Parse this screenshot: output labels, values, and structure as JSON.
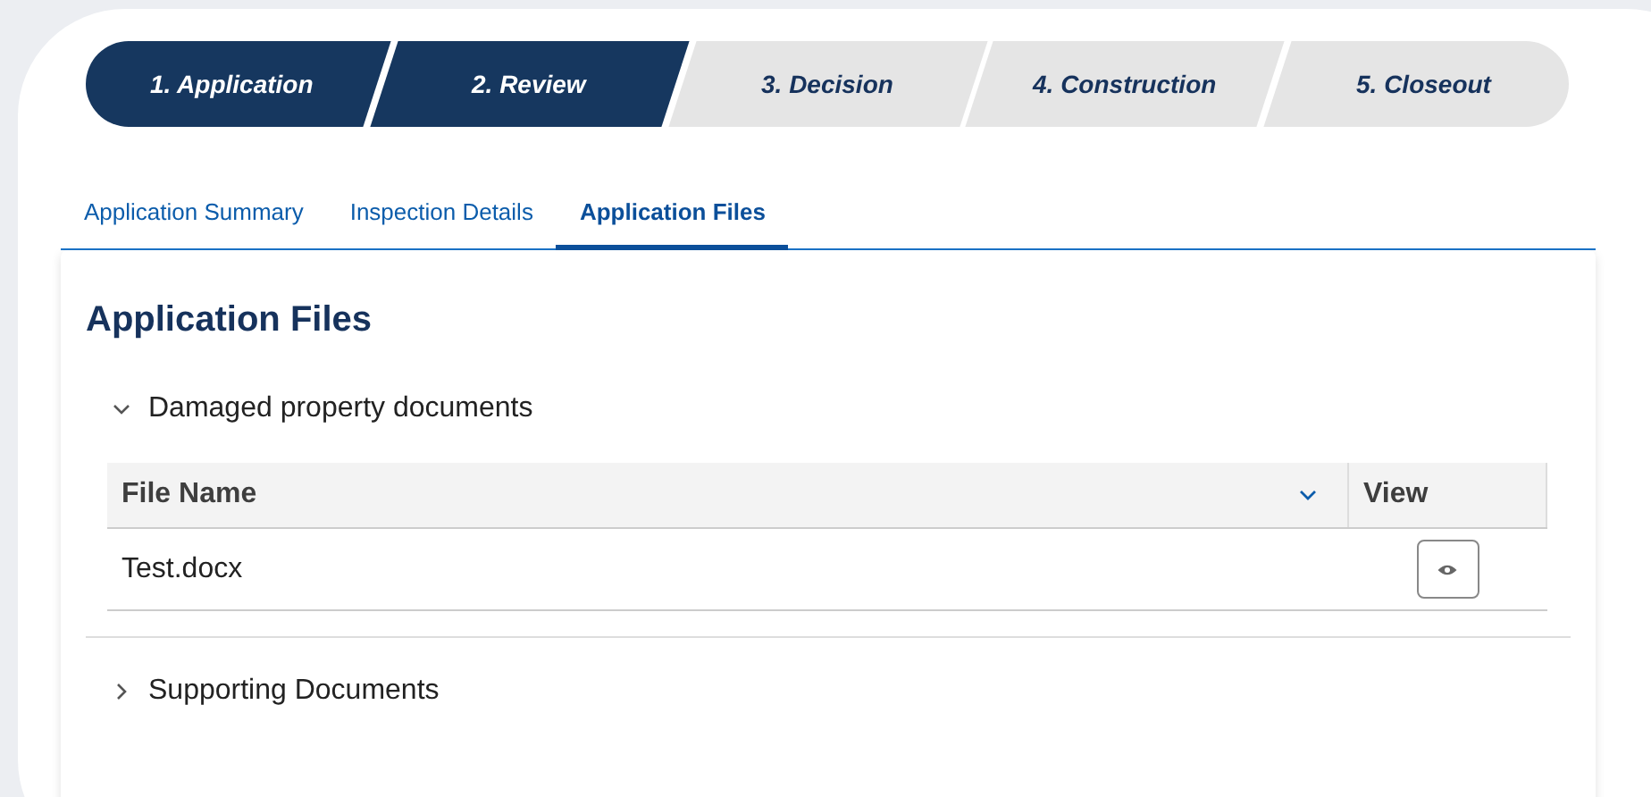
{
  "path": [
    {
      "label": "1. Application",
      "completed": true
    },
    {
      "label": "2. Review",
      "completed": true
    },
    {
      "label": "3. Decision",
      "completed": false
    },
    {
      "label": "4. Construction",
      "completed": false
    },
    {
      "label": "5. Closeout",
      "completed": false
    }
  ],
  "tabs": [
    {
      "label": "Application Summary",
      "selected": false
    },
    {
      "label": "Inspection Details",
      "selected": false
    },
    {
      "label": "Application Files",
      "selected": true
    }
  ],
  "panel": {
    "title": "Application Files",
    "sections": [
      {
        "title": "Damaged property documents",
        "expanded": true,
        "table": {
          "columns": [
            "File Name",
            "View"
          ],
          "rows": [
            {
              "file_name": "Test.docx"
            }
          ]
        }
      },
      {
        "title": "Supporting Documents",
        "expanded": false
      }
    ]
  }
}
